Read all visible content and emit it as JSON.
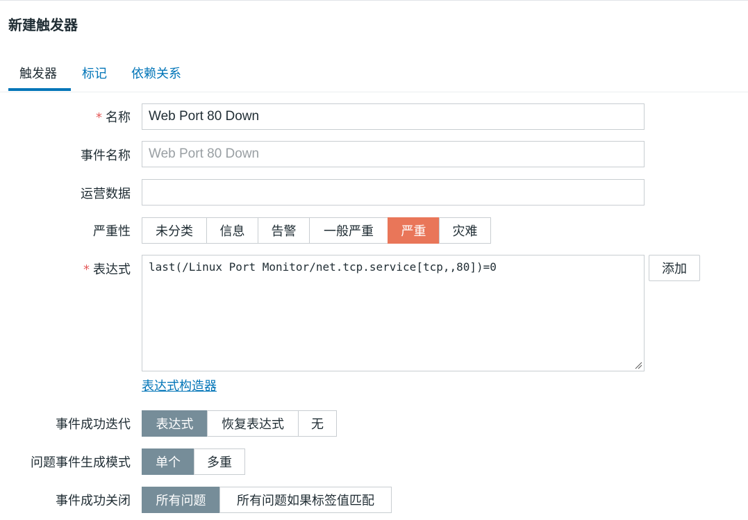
{
  "page": {
    "title": "新建触发器"
  },
  "tabs": [
    {
      "label": "触发器"
    },
    {
      "label": "标记"
    },
    {
      "label": "依赖关系"
    }
  ],
  "form": {
    "required_mark": "*",
    "name": {
      "label": "名称",
      "value": "Web Port 80 Down"
    },
    "event_name": {
      "label": "事件名称",
      "value": "",
      "placeholder": "Web Port 80 Down"
    },
    "opdata": {
      "label": "运营数据",
      "value": ""
    },
    "severity": {
      "label": "严重性",
      "options": [
        "未分类",
        "信息",
        "告警",
        "一般严重",
        "严重",
        "灾难"
      ],
      "selected": "严重",
      "selected_color": "#e97659"
    },
    "expression": {
      "label": "表达式",
      "value": "last(/Linux Port Monitor/net.tcp.service[tcp,,80])=0",
      "add_label": "添加",
      "constructor_link": "表达式构造器"
    },
    "recovery_mode": {
      "label": "事件成功迭代",
      "options": [
        "表达式",
        "恢复表达式",
        "无"
      ],
      "selected": "表达式"
    },
    "problem_mode": {
      "label": "问题事件生成模式",
      "options": [
        "单个",
        "多重"
      ],
      "selected": "单个"
    },
    "ok_close": {
      "label": "事件成功关闭",
      "options": [
        "所有问题",
        "所有问题如果标签值匹配"
      ],
      "selected": "所有问题"
    }
  },
  "colors": {
    "link": "#0275b8",
    "selected_gray": "#768d99",
    "required": "#e45959"
  }
}
